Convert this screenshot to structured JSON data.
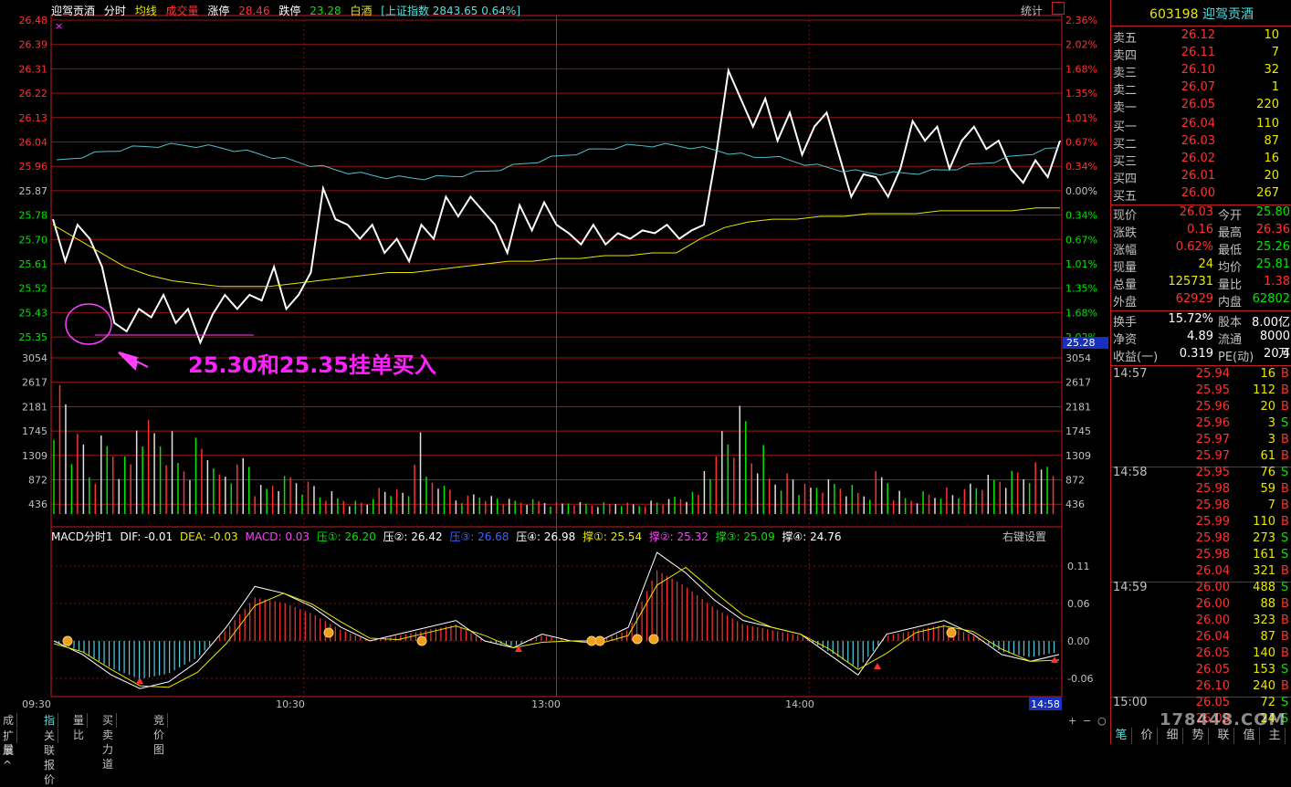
{
  "header": {
    "stock_name": "迎驾贡酒",
    "mode": "分时",
    "avg_line": "均线",
    "volume_label": "成交量",
    "limit_up_label": "涨停",
    "limit_up": "28.46",
    "limit_down_label": "跌停",
    "limit_down": "23.28",
    "sector": "白酒",
    "index_info": "[上证指数 2843.65 0.64%]",
    "stats_btn": "统计",
    "close_mark": "×"
  },
  "price_axis": {
    "left": [
      "26.48",
      "26.39",
      "26.31",
      "26.22",
      "26.13",
      "26.04",
      "25.96",
      "25.87",
      "25.78",
      "25.70",
      "25.61",
      "25.52",
      "25.43",
      "25.35"
    ],
    "right": [
      "2.36%",
      "2.02%",
      "1.68%",
      "1.35%",
      "1.01%",
      "0.67%",
      "0.34%",
      "0.00%",
      "0.34%",
      "0.67%",
      "1.01%",
      "1.35%",
      "1.68%",
      "2.02%"
    ],
    "cursor_value": "25.28"
  },
  "volume_axis": [
    "3054",
    "2617",
    "2181",
    "1745",
    "1309",
    "872",
    "436"
  ],
  "macd_header": {
    "name": "MACD分时1",
    "dif": "DIF: -0.01",
    "dea": "DEA: -0.03",
    "macd": "MACD: 0.03",
    "ya1": "压①: 26.20",
    "ya2": "压②: 26.42",
    "ya3": "压③: 26.68",
    "ya4": "压④: 26.98",
    "cheng1": "撑①: 25.54",
    "cheng2": "撑②: 25.32",
    "cheng3": "撑③: 25.09",
    "cheng4": "撑④: 24.76",
    "right_click": "右键设置"
  },
  "macd_axis": [
    "0.11",
    "0.06",
    "0.00",
    "-0.06"
  ],
  "time_axis": [
    "09:30",
    "10:30",
    "13:00",
    "14:00"
  ],
  "time_cursor": "14:58",
  "annotation": "25.30和25.35挂单买入",
  "bottom_tabs": [
    "成交量",
    "指标",
    "量比",
    "买卖力道",
    "竞价图"
  ],
  "bottom_tabs2": [
    "扩展^",
    "关联报价"
  ],
  "panel": {
    "code": "603198",
    "name": "迎驾贡酒",
    "sell": [
      {
        "label": "卖五",
        "price": "26.12",
        "vol": "10"
      },
      {
        "label": "卖四",
        "price": "26.11",
        "vol": "7"
      },
      {
        "label": "卖三",
        "price": "26.10",
        "vol": "32"
      },
      {
        "label": "卖二",
        "price": "26.07",
        "vol": "1"
      },
      {
        "label": "卖一",
        "price": "26.05",
        "vol": "220"
      }
    ],
    "buy": [
      {
        "label": "买一",
        "price": "26.04",
        "vol": "110"
      },
      {
        "label": "买二",
        "price": "26.03",
        "vol": "87"
      },
      {
        "label": "买三",
        "price": "26.02",
        "vol": "16"
      },
      {
        "label": "买四",
        "price": "26.01",
        "vol": "20"
      },
      {
        "label": "买五",
        "price": "26.00",
        "vol": "267"
      }
    ],
    "quote": [
      {
        "l1": "现价",
        "v1": "26.03",
        "l2": "今开",
        "v2": "25.80",
        "c1": "red",
        "c2": "green"
      },
      {
        "l1": "涨跌",
        "v1": "0.16",
        "l2": "最高",
        "v2": "26.36",
        "c1": "red",
        "c2": "red"
      },
      {
        "l1": "涨幅",
        "v1": "0.62%",
        "l2": "最低",
        "v2": "25.26",
        "c1": "red",
        "c2": "green"
      },
      {
        "l1": "现量",
        "v1": "24",
        "l2": "均价",
        "v2": "25.81",
        "c1": "yellow",
        "c2": "green"
      },
      {
        "l1": "总量",
        "v1": "125731",
        "l2": "量比",
        "v2": "1.38",
        "c1": "yellow",
        "c2": "red"
      },
      {
        "l1": "外盘",
        "v1": "62929",
        "l2": "内盘",
        "v2": "62802",
        "c1": "red",
        "c2": "green"
      }
    ],
    "info": [
      {
        "l1": "换手",
        "v1": "15.72%",
        "l2": "股本",
        "v2": "8.00亿"
      },
      {
        "l1": "净资",
        "v1": "4.89",
        "l2": "流通",
        "v2": "8000万"
      },
      {
        "l1": "收益(一)",
        "v1": "0.319",
        "l2": "PE(动)",
        "v2": "20.4"
      }
    ],
    "ticks": [
      {
        "t": "14:57",
        "p": "25.94",
        "v": "16",
        "s": "B"
      },
      {
        "t": "",
        "p": "25.95",
        "v": "112",
        "s": "B"
      },
      {
        "t": "",
        "p": "25.96",
        "v": "20",
        "s": "B"
      },
      {
        "t": "",
        "p": "25.96",
        "v": "3",
        "s": "S"
      },
      {
        "t": "",
        "p": "25.97",
        "v": "3",
        "s": "B"
      },
      {
        "t": "",
        "p": "25.97",
        "v": "61",
        "s": "B"
      },
      {
        "t": "14:58",
        "p": "25.95",
        "v": "76",
        "s": "S"
      },
      {
        "t": "",
        "p": "25.98",
        "v": "59",
        "s": "B"
      },
      {
        "t": "",
        "p": "25.98",
        "v": "7",
        "s": "B"
      },
      {
        "t": "",
        "p": "25.99",
        "v": "110",
        "s": "B"
      },
      {
        "t": "",
        "p": "25.98",
        "v": "273",
        "s": "S"
      },
      {
        "t": "",
        "p": "25.98",
        "v": "161",
        "s": "S"
      },
      {
        "t": "",
        "p": "26.04",
        "v": "321",
        "s": "B"
      },
      {
        "t": "14:59",
        "p": "26.00",
        "v": "488",
        "s": "S"
      },
      {
        "t": "",
        "p": "26.00",
        "v": "88",
        "s": "B"
      },
      {
        "t": "",
        "p": "26.00",
        "v": "323",
        "s": "B"
      },
      {
        "t": "",
        "p": "26.04",
        "v": "87",
        "s": "B"
      },
      {
        "t": "",
        "p": "26.05",
        "v": "140",
        "s": "B"
      },
      {
        "t": "",
        "p": "26.05",
        "v": "153",
        "s": "S"
      },
      {
        "t": "",
        "p": "26.10",
        "v": "240",
        "s": "B"
      },
      {
        "t": "15:00",
        "p": "26.05",
        "v": "72",
        "s": "S"
      },
      {
        "t": "",
        "p": "26.03",
        "v": "24",
        "s": "S"
      }
    ],
    "bottom_tabs": [
      "笔",
      "价",
      "细",
      "势",
      "联",
      "值",
      "主"
    ]
  },
  "watermark": "178448.COM",
  "chart_data": {
    "type": "line",
    "price_base": 25.87,
    "ylim": [
      25.35,
      26.48
    ],
    "x_ticks": [
      "09:30",
      "10:30",
      "13:00",
      "14:00"
    ],
    "price": [
      25.77,
      25.62,
      25.75,
      25.7,
      25.6,
      25.4,
      25.37,
      25.45,
      25.42,
      25.5,
      25.4,
      25.45,
      25.33,
      25.43,
      25.5,
      25.45,
      25.5,
      25.48,
      25.6,
      25.45,
      25.5,
      25.58,
      25.88,
      25.77,
      25.75,
      25.7,
      25.75,
      25.65,
      25.7,
      25.62,
      25.75,
      25.7,
      25.85,
      25.78,
      25.85,
      25.8,
      25.75,
      25.65,
      25.82,
      25.73,
      25.83,
      25.75,
      25.72,
      25.68,
      25.75,
      25.68,
      25.72,
      25.7,
      25.73,
      25.72,
      25.75,
      25.7,
      25.73,
      25.75,
      26.0,
      26.3,
      26.2,
      26.1,
      26.2,
      26.05,
      26.15,
      26.0,
      26.1,
      26.15,
      26.0,
      25.85,
      25.93,
      25.92,
      25.85,
      25.95,
      26.12,
      26.05,
      26.1,
      25.95,
      26.05,
      26.1,
      26.02,
      26.05,
      25.95,
      25.9,
      25.98,
      25.92,
      26.05
    ],
    "avg": [
      25.75,
      25.7,
      25.65,
      25.6,
      25.57,
      25.55,
      25.54,
      25.53,
      25.53,
      25.53,
      25.54,
      25.55,
      25.56,
      25.57,
      25.58,
      25.58,
      25.59,
      25.6,
      25.61,
      25.62,
      25.62,
      25.63,
      25.63,
      25.64,
      25.64,
      25.65,
      25.65,
      25.7,
      25.74,
      25.76,
      25.77,
      25.77,
      25.78,
      25.78,
      25.79,
      25.79,
      25.79,
      25.8,
      25.8,
      25.8,
      25.8,
      25.81,
      25.81
    ],
    "volume": [
      2900,
      1600,
      1000,
      1600,
      1200,
      2400,
      2000,
      1800,
      1300,
      1700,
      900,
      1000,
      1300,
      600,
      800,
      900,
      700,
      500,
      400,
      300,
      300,
      600,
      500,
      1700,
      900,
      600,
      400,
      500,
      400,
      300,
      300,
      300,
      250,
      300,
      250,
      250,
      300,
      250,
      300,
      300,
      400,
      450,
      1200,
      2000,
      2300,
      1500,
      900,
      900,
      600,
      700,
      700,
      600,
      500,
      900,
      500,
      400,
      500,
      600,
      500,
      700,
      800,
      900,
      1000,
      1100,
      1400
    ],
    "macd_lines": [
      0.0,
      -0.02,
      -0.05,
      -0.07,
      -0.06,
      -0.03,
      0.02,
      0.08,
      0.07,
      0.05,
      0.02,
      0.0,
      0.01,
      0.02,
      0.03,
      0.0,
      -0.01,
      0.01,
      0.0,
      0.0,
      0.02,
      0.13,
      0.1,
      0.06,
      0.03,
      0.02,
      0.01,
      -0.02,
      -0.05,
      0.01,
      0.02,
      0.03,
      0.01,
      -0.02,
      -0.03,
      -0.02
    ]
  }
}
